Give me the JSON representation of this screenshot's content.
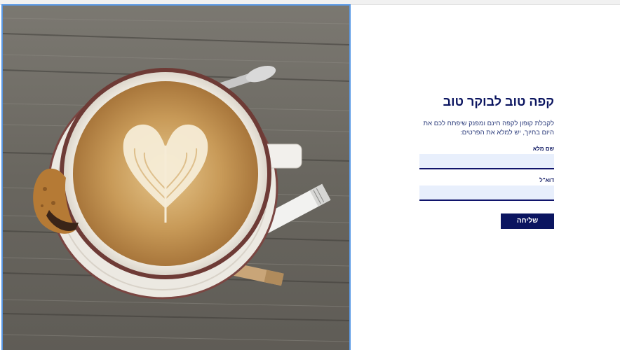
{
  "form": {
    "title": "קפה טוב לבוקר טוב",
    "subtitle_line1": "לקבלת קופון לקפה חינם ומפנק שיפתח לכם את",
    "subtitle_line2": "היום בחיוך, יש למלא את הפרטים:",
    "fields": [
      {
        "label": "שם מלא",
        "value": "",
        "placeholder": ""
      },
      {
        "label": "דוא\"ל",
        "value": "",
        "placeholder": ""
      }
    ],
    "submit_label": "שליחה"
  },
  "image": {
    "subject": "latte-art-heart-coffee-cup-on-wooden-table",
    "colors": {
      "wood": "#6f6d68",
      "coffee": "#c9a063",
      "foam": "#f6ecd6",
      "saucer": "#ece9e2",
      "rim": "#6e3b36"
    }
  },
  "colors": {
    "primary": "#0b1560",
    "input_bg": "#e8effc",
    "selection_outline": "#5b9ae6"
  }
}
